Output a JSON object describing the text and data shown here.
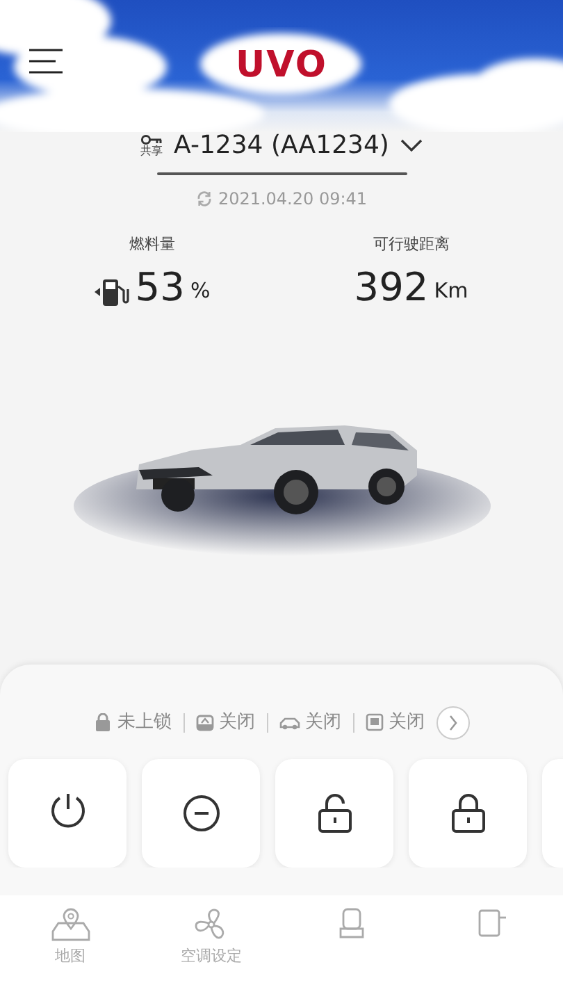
{
  "header": {
    "logo": "UVO"
  },
  "vehicle": {
    "share_label": "共享",
    "name": "A-1234 (AA1234)",
    "updated": "2021.04.20 09:41"
  },
  "stats": [
    {
      "kind": "fuel",
      "label": "燃料量",
      "value": "53",
      "unit": "%"
    },
    {
      "kind": "range",
      "label": "可行驶距离",
      "value": "392",
      "unit": "Km"
    }
  ],
  "status": [
    {
      "kind": "lock",
      "text": "未上锁"
    },
    {
      "kind": "trunk",
      "text": "关闭"
    },
    {
      "kind": "sunroof",
      "text": "关闭"
    },
    {
      "kind": "window",
      "text": "关闭"
    }
  ],
  "actions": [
    {
      "kind": "power"
    },
    {
      "kind": "stop"
    },
    {
      "kind": "unlock"
    },
    {
      "kind": "lock"
    },
    {
      "kind": "blank"
    }
  ],
  "nav": [
    {
      "kind": "map",
      "label": "地图"
    },
    {
      "kind": "fan",
      "label": "空调设定"
    },
    {
      "kind": "seat"
    },
    {
      "kind": "device"
    }
  ]
}
